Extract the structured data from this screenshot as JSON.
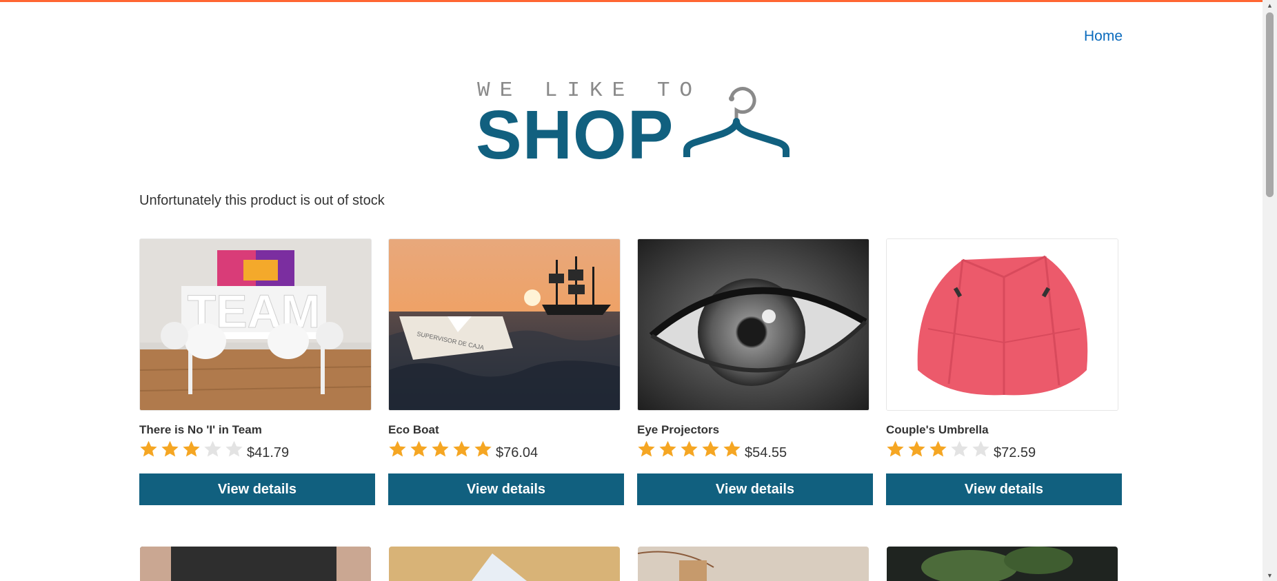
{
  "header": {
    "home_link": "Home",
    "accent_color": "#ff6633"
  },
  "logo": {
    "top_text": "WE LIKE TO",
    "main_text": "SHOP",
    "icon": "clothes-hanger-icon"
  },
  "message": "Unfortunately this product is out of stock",
  "products": [
    {
      "title": "There is No 'I' in Team",
      "rating": 3,
      "max_rating": 5,
      "price": "$41.79",
      "button": "View details",
      "image": "team-meeting-room-image"
    },
    {
      "title": "Eco Boat",
      "rating": 5,
      "max_rating": 5,
      "price": "$76.04",
      "button": "View details",
      "image": "paper-boat-sunset-image"
    },
    {
      "title": "Eye Projectors",
      "rating": 5,
      "max_rating": 5,
      "price": "$54.55",
      "button": "View details",
      "image": "eye-closeup-image"
    },
    {
      "title": "Couple's Umbrella",
      "rating": 3,
      "max_rating": 5,
      "price": "$72.59",
      "button": "View details",
      "image": "pink-umbrella-image"
    }
  ],
  "colors": {
    "brand": "#11607f",
    "link": "#0b6bbd",
    "star_filled": "#f5a623",
    "star_empty": "#e3e3e3"
  }
}
